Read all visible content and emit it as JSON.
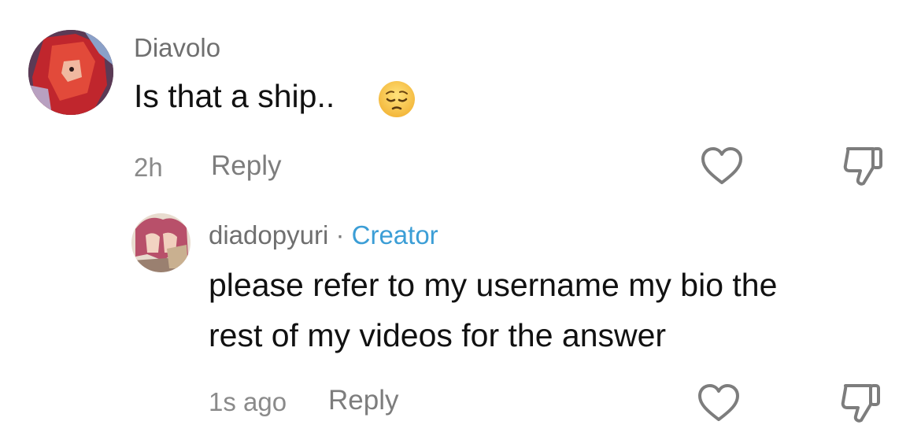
{
  "comment": {
    "username": "Diavolo",
    "text": "Is that a ship..",
    "emoji": "pensive-face",
    "timestamp": "2h",
    "reply_label": "Reply"
  },
  "reply": {
    "username": "diadopyuri",
    "separator": "·",
    "badge": "Creator",
    "text_line1": "please refer to my username my bio the",
    "text_line2": "rest of my videos for the answer",
    "timestamp": "1s ago",
    "reply_label": "Reply"
  },
  "colors": {
    "accent_creator": "#3c9ed6",
    "muted_text": "#7d7d7d",
    "body_text": "#111111"
  }
}
